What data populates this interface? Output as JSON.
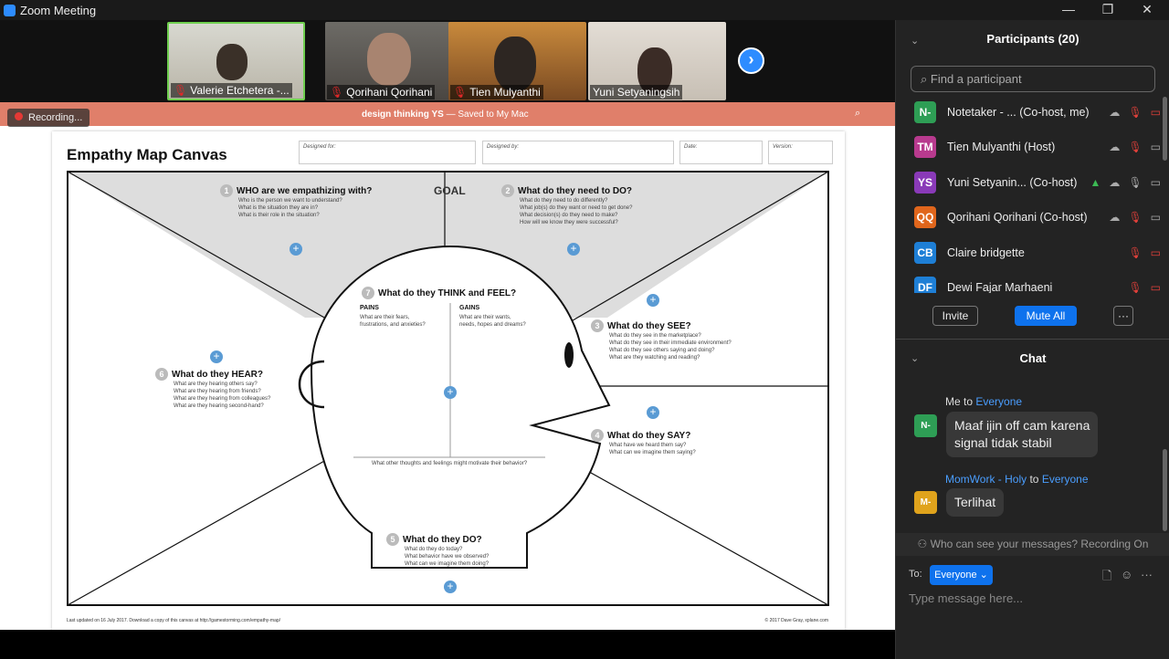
{
  "window": {
    "title": "Zoom Meeting",
    "minimize": "—",
    "maximize": "❐",
    "close": "✕"
  },
  "video": {
    "tiles": [
      {
        "name": "Valerie Etchetera -..."
      },
      {
        "name": "Qorihani Qorihani"
      },
      {
        "name": "Tien Mulyanthi"
      },
      {
        "name": "Yuni Setyaningsih"
      }
    ],
    "next": "›"
  },
  "share": {
    "recording": "Recording...",
    "doc_title": "design thinking YS",
    "doc_status": " — Saved to My Mac"
  },
  "canvas": {
    "title": "Empathy Map Canvas",
    "fields": [
      "Designed for:",
      "Designed by:",
      "Date:",
      "Version:"
    ],
    "goal": "GOAL",
    "s1": {
      "num": "1",
      "title": "WHO are we empathizing with?",
      "lines": [
        "Who is the person we want to understand?",
        "What is the situation they are in?",
        "What is their role in the situation?"
      ]
    },
    "s2": {
      "num": "2",
      "title": "What do they need to DO?",
      "lines": [
        "What do they need to do differently?",
        "What job(s) do they want or need to get done?",
        "What decision(s) do they need to make?",
        "How will we know they were successful?"
      ]
    },
    "s3": {
      "num": "3",
      "title": "What do they SEE?",
      "lines": [
        "What do they see in the marketplace?",
        "What do they see in their immediate environment?",
        "What do they see others saying and doing?",
        "What are they watching and reading?"
      ]
    },
    "s4": {
      "num": "4",
      "title": "What do they SAY?",
      "lines": [
        "What have we heard them say?",
        "What can we imagine them saying?"
      ]
    },
    "s5": {
      "num": "5",
      "title": "What do they DO?",
      "lines": [
        "What do they do today?",
        "What behavior have we observed?",
        "What can we imagine them doing?"
      ]
    },
    "s6": {
      "num": "6",
      "title": "What do they HEAR?",
      "lines": [
        "What are they hearing others say?",
        "What are they hearing from friends?",
        "What are they hearing from colleagues?",
        "What are they hearing second-hand?"
      ]
    },
    "s7": {
      "num": "7",
      "title": "What do they THINK and FEEL?",
      "pains": "PAINS",
      "pains_lines": [
        "What are their fears,",
        "frustrations, and anxieties?"
      ],
      "gains": "GAINS",
      "gains_lines": [
        "What are their wants,",
        "needs, hopes and dreams?"
      ],
      "motivate": "What other thoughts and feelings might motivate their behavior?"
    },
    "footer_left": "Last updated on 16 July 2017. Download a copy of this canvas at http://gamestorming.com/empathy-map/",
    "footer_right": "© 2017 Dave Gray, xplane.com"
  },
  "participants": {
    "header": "Participants (20)",
    "search_placeholder": "Find a participant",
    "list": [
      {
        "initials": "N-",
        "name": "Notetaker - ... (Co-host, me)",
        "color": "#2e9e55"
      },
      {
        "initials": "TM",
        "name": "Tien Mulyanthi (Host)",
        "color": "#b83a8e"
      },
      {
        "initials": "YS",
        "name": "Yuni Setyanin... (Co-host)",
        "color": "#8a3ab8"
      },
      {
        "initials": "QQ",
        "name": "Qorihani Qorihani (Co-host)",
        "color": "#e0661c"
      },
      {
        "initials": "CB",
        "name": "Claire bridgette",
        "color": "#1e7fd6"
      },
      {
        "initials": "DF",
        "name": "Dewi Fajar Marhaeni",
        "color": "#1e7fd6"
      }
    ],
    "invite": "Invite",
    "mute_all": "Mute All",
    "more": "···"
  },
  "chat": {
    "header": "Chat",
    "messages": [
      {
        "from": "Me",
        "to_word": " to ",
        "to": "Everyone",
        "avatar": "N-",
        "avatar_color": "#2e9e55",
        "lines": [
          "Maaf ijin off cam karena",
          "signal tidak stabil"
        ]
      },
      {
        "from": "MomWork - Holy",
        "to_word": " to ",
        "to": "Everyone",
        "avatar": "M-",
        "avatar_color": "#e0a31c",
        "lines": [
          "Terlihat"
        ]
      }
    ],
    "notice": "Who can see your messages? Recording On",
    "to_label": "To:",
    "to_value": "Everyone ⌄",
    "input_placeholder": "Type message here..."
  }
}
